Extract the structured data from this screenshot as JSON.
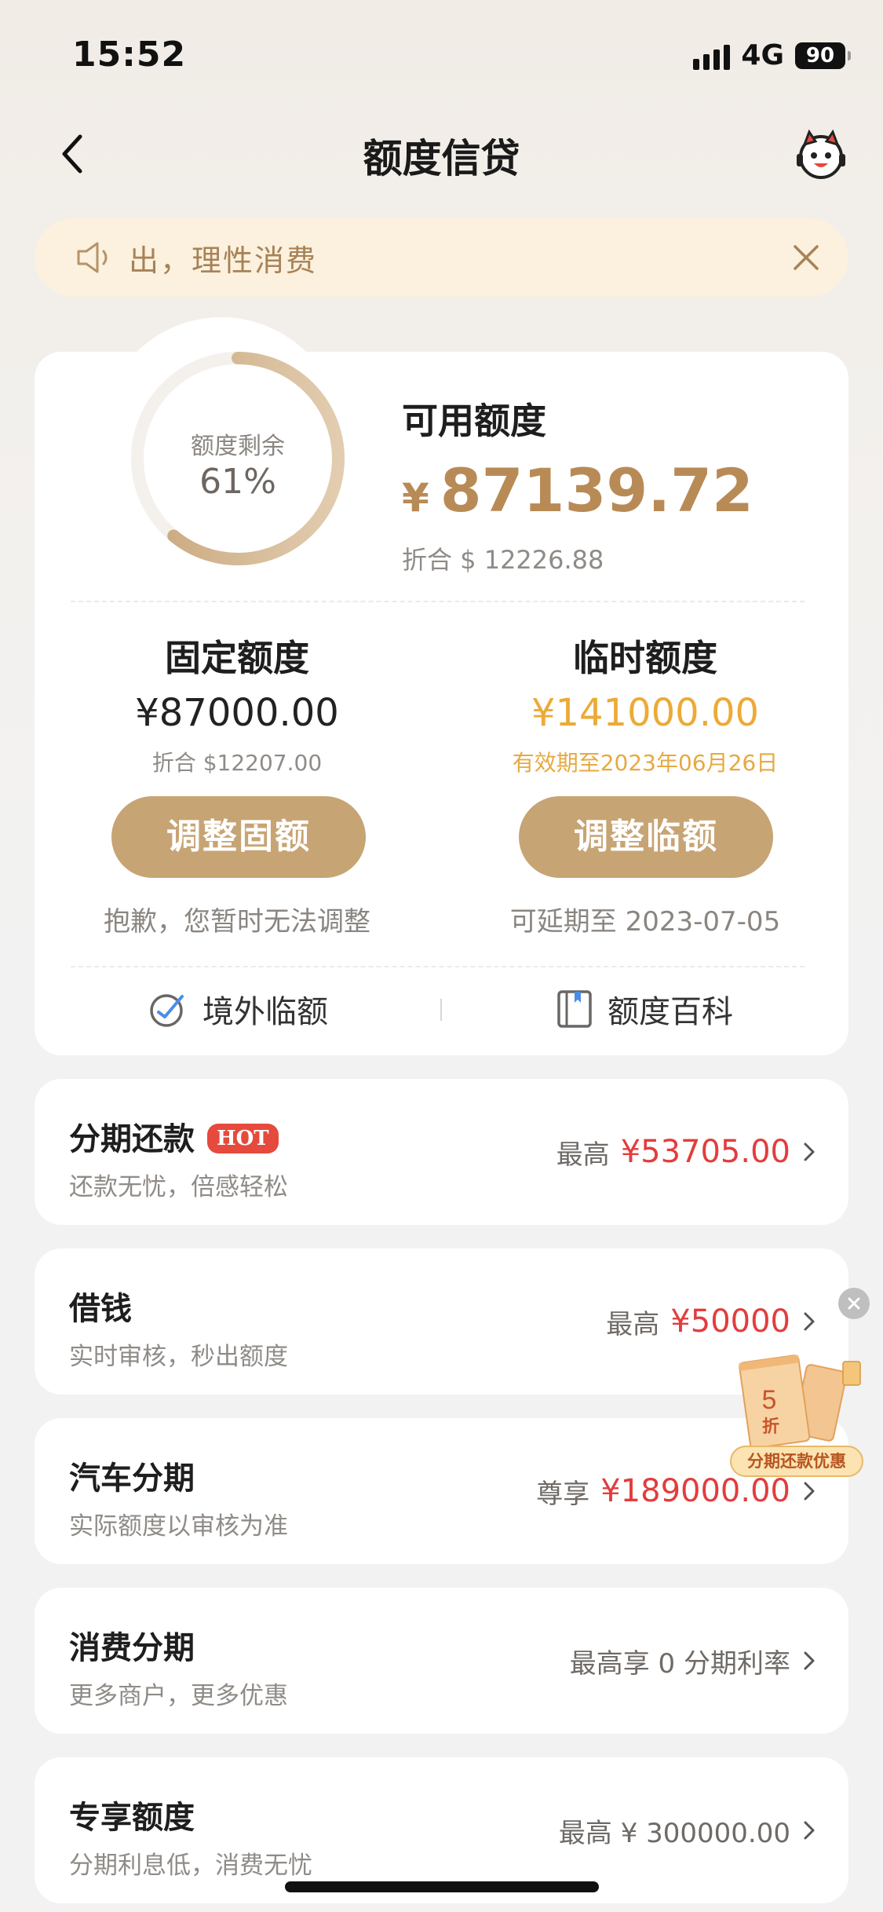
{
  "status_bar": {
    "time": "15:52",
    "network": "4G",
    "battery": "90"
  },
  "nav": {
    "title": "额度信贷"
  },
  "notice": {
    "text": "出，理性消费"
  },
  "summary": {
    "ring_label": "额度剩余",
    "ring_percent_text": "61%",
    "remaining_fraction": 0.61,
    "available_label": "可用额度",
    "currency": "¥",
    "available_amount": "87139.72",
    "available_usd": "折合 $ 12226.88"
  },
  "fixed": {
    "title": "固定额度",
    "amount": "¥87000.00",
    "usd": "折合 $12207.00",
    "button": "调整固额",
    "note": "抱歉，您暂时无法调整"
  },
  "temp": {
    "title": "临时额度",
    "amount": "¥141000.00",
    "validity": "有效期至2023年06月26日",
    "button": "调整临额",
    "note": "可延期至 2023-07-05"
  },
  "links": {
    "overseas": "境外临额",
    "wiki": "额度百科"
  },
  "items": [
    {
      "title": "分期还款",
      "badge": "HOT",
      "sub": "还款无忧，倍感轻松",
      "prefix": "最高",
      "value": "¥53705.00"
    },
    {
      "title": "借钱",
      "sub": "实时审核，秒出额度",
      "prefix": "最高",
      "value": "¥50000"
    },
    {
      "title": "汽车分期",
      "sub": "实际额度以审核为准",
      "prefix": "尊享",
      "value": "¥189000.00"
    },
    {
      "title": "消费分期",
      "sub": "更多商户，更多优惠",
      "plain": "最高享 0 分期利率"
    },
    {
      "title": "专享额度",
      "sub": "分期利息低，消费无忧",
      "plain": "最高 ¥ 300000.00"
    }
  ],
  "promo": {
    "badge": "分期还款优惠",
    "discount": "5",
    "unit": "折"
  },
  "colors": {
    "gold": "#c7a474",
    "accent_red": "#e23d3d",
    "temp_gold": "#ecaa36"
  }
}
